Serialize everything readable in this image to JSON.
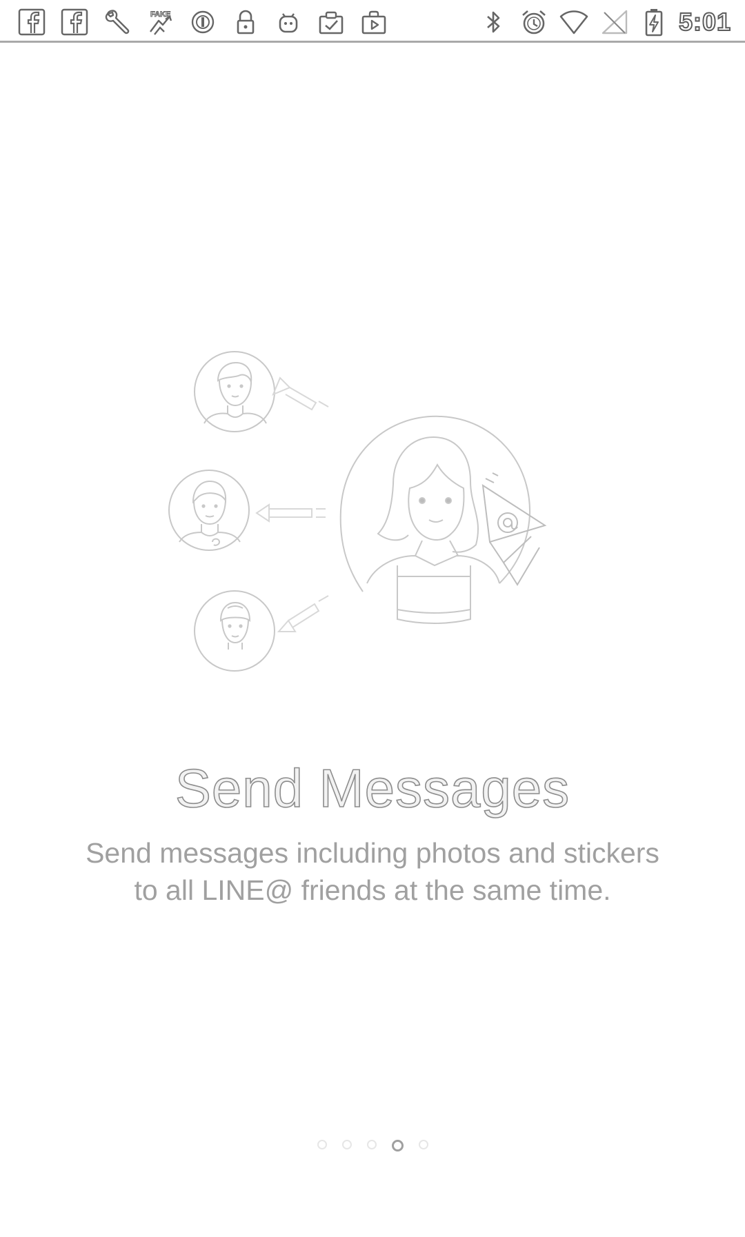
{
  "status_bar": {
    "time": "5:01",
    "left_icons": [
      "facebook-icon",
      "facebook-icon",
      "wrench-icon",
      "fake-gps-icon",
      "circle-badge-icon",
      "lock-icon",
      "android-icon",
      "clipboard-check-icon",
      "play-store-icon"
    ],
    "right_icons": [
      "bluetooth-icon",
      "alarm-icon",
      "wifi-icon",
      "no-sim-icon",
      "battery-charging-icon"
    ],
    "fake_label": "FAKE"
  },
  "onboarding": {
    "title": "Send Messages",
    "description": "Send messages including photos and stickers\nto all LINE@ friends at the same time.",
    "illustration": "send-messages-illustration",
    "at_symbol": "@"
  },
  "pager": {
    "total": 5,
    "active_index": 3
  }
}
